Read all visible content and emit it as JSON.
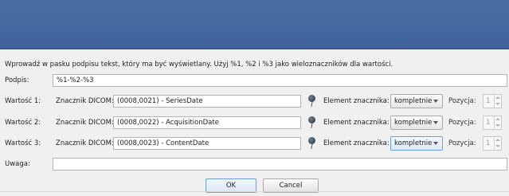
{
  "instruction": "Wprowadź w pasku podpisu tekst, który ma być wyświetlany. Użyj %1, %2 i %3 jako wieloznaczników dla wartości.",
  "signature": {
    "label": "Podpis:",
    "value": "%1-%2-%3"
  },
  "rows": [
    {
      "label": "Wartość 1:",
      "tag_label": "Znacznik DICOM:",
      "tag_value": "(0008,0021) - SeriesDate",
      "element_label": "Element znacznika:",
      "element_value": "kompletnie",
      "position_label": "Pozycja:",
      "position_value": "1"
    },
    {
      "label": "Wartość 2:",
      "tag_label": "Znacznik DICOM:",
      "tag_value": "(0008,0022) - AcquisitionDate",
      "element_label": "Element znacznika:",
      "element_value": "kompletnie",
      "position_label": "Pozycja:",
      "position_value": "1"
    },
    {
      "label": "Wartość 3:",
      "tag_label": "Znacznik DICOM:",
      "tag_value": "(0008,0023) - ContentDate",
      "element_label": "Element znacznika:",
      "element_value": "kompletnie",
      "position_label": "Pozycja:",
      "position_value": "1"
    }
  ],
  "note": {
    "label": "Uwaga:",
    "value": ""
  },
  "buttons": {
    "ok": "OK",
    "cancel": "Cancel"
  },
  "colors": {
    "titlebar": "#4a6fa5",
    "background": "#f0f0f0",
    "focus_border": "#6f9fd8"
  },
  "icons": {
    "tag_picker": "pushpin-icon",
    "dropdown": "chevron-down-icon"
  }
}
